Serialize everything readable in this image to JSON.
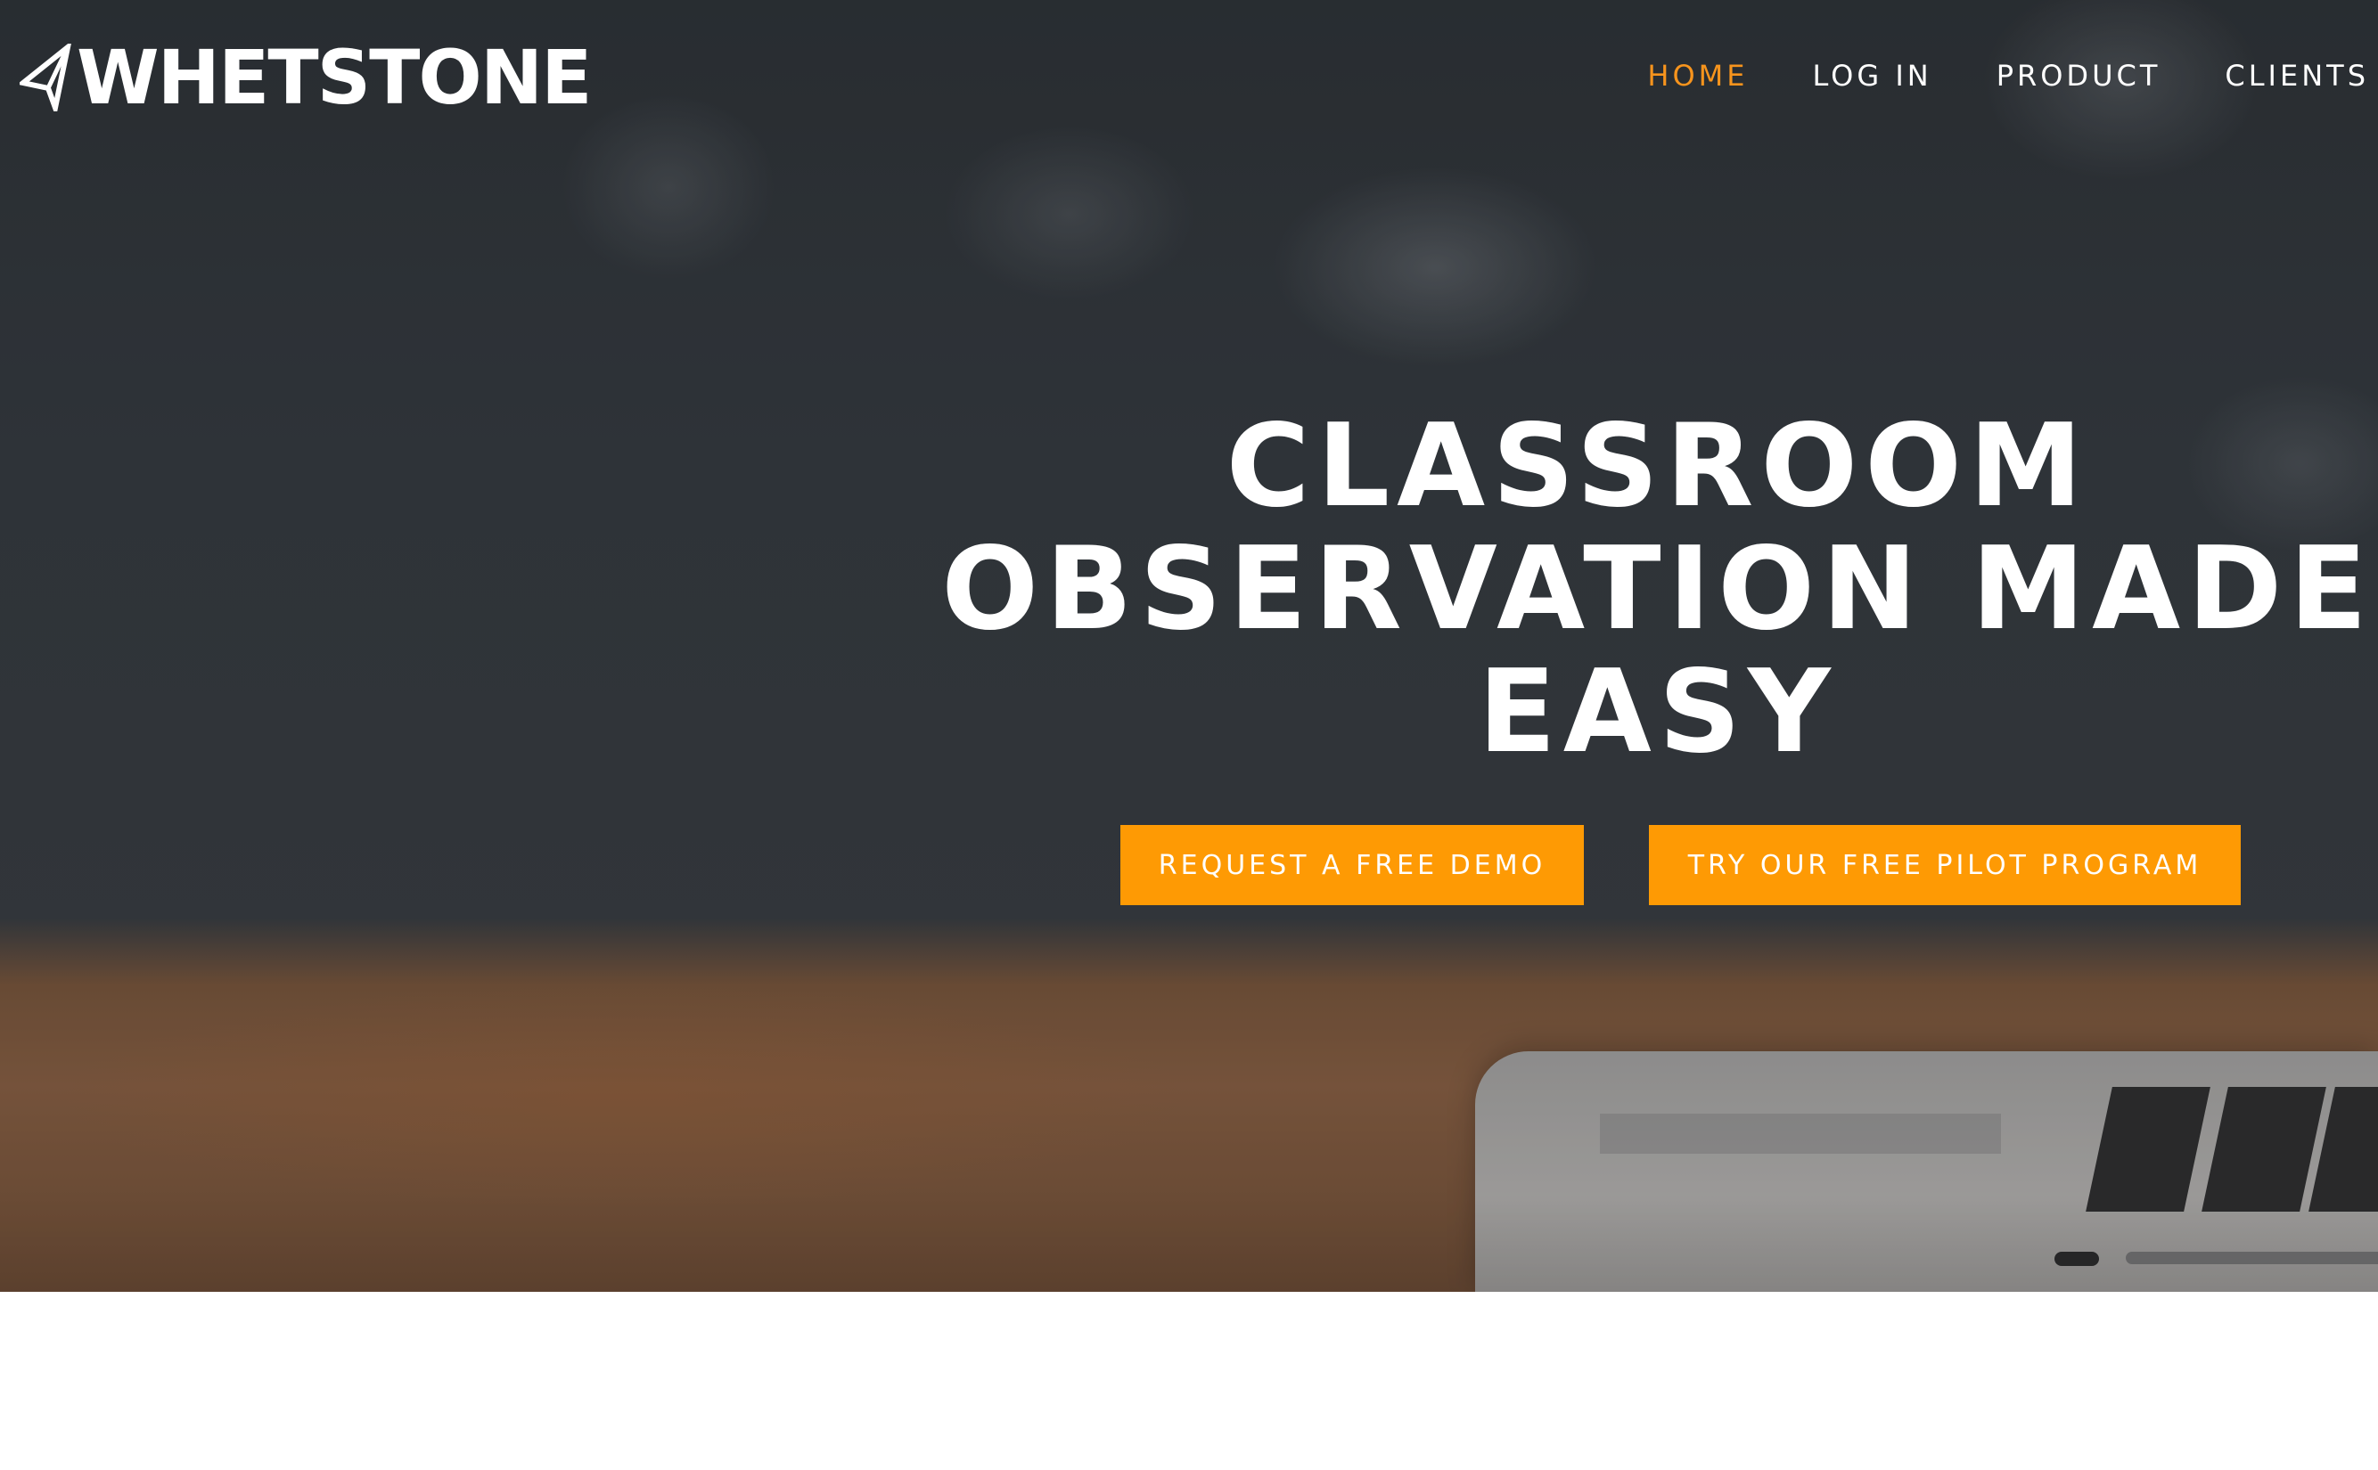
{
  "brand": {
    "name": "WHETSTONE",
    "icon": "paper-plane-icon"
  },
  "nav": {
    "items": [
      {
        "label": "HOME",
        "active": true
      },
      {
        "label": "LOG IN",
        "active": false
      },
      {
        "label": "PRODUCT",
        "active": false
      },
      {
        "label": "CLIENTS",
        "active": false
      }
    ]
  },
  "hero": {
    "headline_lines": [
      "CLASSROOM",
      "OBSERVATION MADE",
      "EASY"
    ],
    "buttons": {
      "demo_label": "REQUEST A FREE DEMO",
      "pilot_label": "TRY OUR FREE PILOT PROGRAM"
    }
  },
  "colors": {
    "accent": "#fe9a04",
    "nav_active": "#f7941d",
    "text_light": "#ffffff"
  }
}
